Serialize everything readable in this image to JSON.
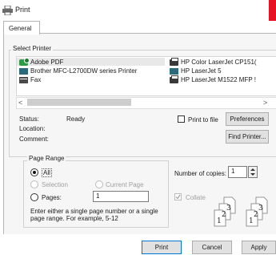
{
  "window": {
    "title": "Print"
  },
  "tabs": [
    {
      "label": "General",
      "selected": true
    }
  ],
  "select_printer": {
    "title": "Select Printer",
    "printers": [
      {
        "label": "Adobe PDF",
        "icon": "pdf-printer-icon",
        "selected": true
      },
      {
        "label": "Brother MFC-L2700DW series Printer",
        "icon": "network-printer-icon"
      },
      {
        "label": "Fax",
        "icon": "fax-icon"
      },
      {
        "label": "HP Color LaserJet CP151(",
        "icon": "printer-icon"
      },
      {
        "label": "HP LaserJet 5",
        "icon": "network-printer-icon"
      },
      {
        "label": "HP LaserJet M1522 MFP !",
        "icon": "printer-icon"
      }
    ],
    "scroll_left": "<",
    "scroll_right": ">",
    "status_label": "Status:",
    "status_value": "Ready",
    "location_label": "Location:",
    "comment_label": "Comment:",
    "print_to_file_label": "Print to file",
    "print_to_file_checked": false,
    "preferences_label": "Preferences",
    "find_printer_label": "Find Printer..."
  },
  "page_range": {
    "title": "Page Range",
    "all_label": "All",
    "selection_label": "Selection",
    "current_page_label": "Current Page",
    "pages_label": "Pages:",
    "pages_value": "1",
    "selected_option": "all",
    "help_text_line1": "Enter either a single page number or a single",
    "help_text_line2": "page range.  For example, 5-12"
  },
  "copies": {
    "label": "Number of copies:",
    "value": "1",
    "collate_label": "Collate",
    "collate_checked": true,
    "collate_enabled": false
  },
  "buttons": {
    "print": "Print",
    "cancel": "Cancel",
    "apply": "Apply"
  },
  "colors": {
    "close_red": "#e81123",
    "selection_gray": "#e8e8e8",
    "panel_bg": "#f6f6f6"
  }
}
